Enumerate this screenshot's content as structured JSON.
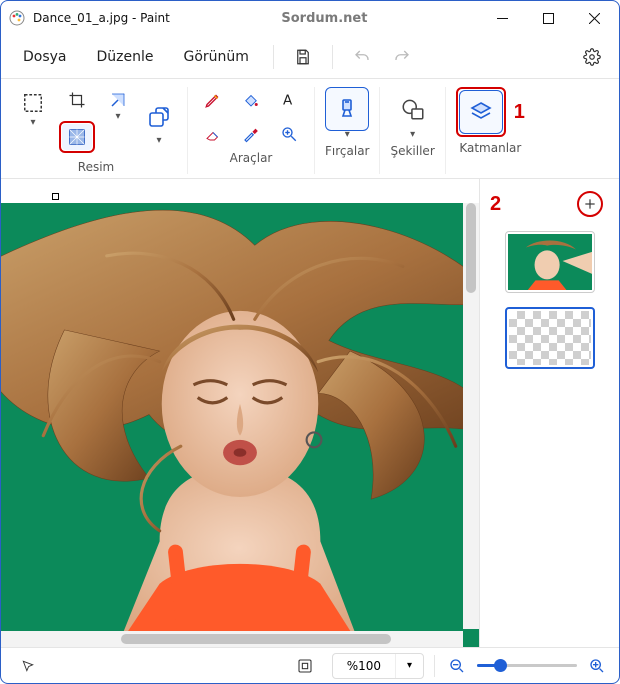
{
  "titlebar": {
    "title": "Dance_01_a.jpg - Paint",
    "watermark": "Sordum.net"
  },
  "menu": {
    "file": "Dosya",
    "edit": "Düzenle",
    "view": "Görünüm"
  },
  "ribbon": {
    "image_group": "Resim",
    "tools_group": "Araçlar",
    "brushes_group": "Fırçalar",
    "shapes_group": "Şekiller",
    "layers_group": "Katmanlar"
  },
  "annotations": {
    "one": "1",
    "two": "2"
  },
  "status": {
    "zoom_value": "%100"
  }
}
